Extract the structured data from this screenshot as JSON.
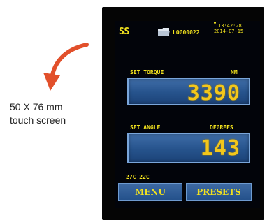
{
  "annotation": {
    "line1": "50 X 76 mm",
    "line2": "touch screen",
    "arrow_color": "#e2502b"
  },
  "screen": {
    "logo": "SS",
    "folder_icon": "folder-icon",
    "filename": "LOG00022",
    "time": "13:42:28",
    "date": "2014-07-15",
    "torque": {
      "label": "SET TORQUE",
      "unit": "NM",
      "value": "3390"
    },
    "angle": {
      "label": "SET ANGLE",
      "unit": "DEGREES",
      "value": "143"
    },
    "temp1": "27C",
    "temp2": "22C",
    "menu_button": "MENU",
    "presets_button": "PRESETS",
    "colors": {
      "text": "#f2e21e",
      "value": "#f3c71b",
      "box": "#26538c",
      "background": "#02040a"
    }
  }
}
